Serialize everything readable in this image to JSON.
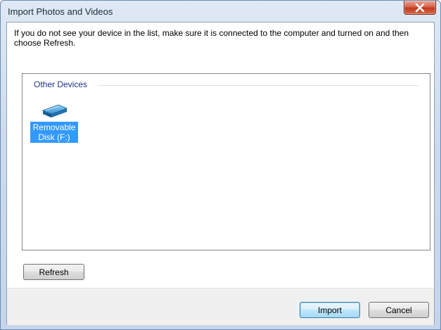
{
  "window": {
    "title": "Import Photos and Videos"
  },
  "instructions": "If you do not see your device in the list, make sure it is connected to the computer and turned on and then choose Refresh.",
  "devices": {
    "group_label": "Other Devices",
    "items": [
      {
        "label": "Removable Disk (F:)",
        "icon": "removable-disk-icon",
        "selected": true
      }
    ]
  },
  "buttons": {
    "refresh": "Refresh",
    "import": "Import",
    "cancel": "Cancel"
  },
  "colors": {
    "selection": "#3399ff",
    "group_label": "#1e3287",
    "close_button": "#c2391f"
  }
}
